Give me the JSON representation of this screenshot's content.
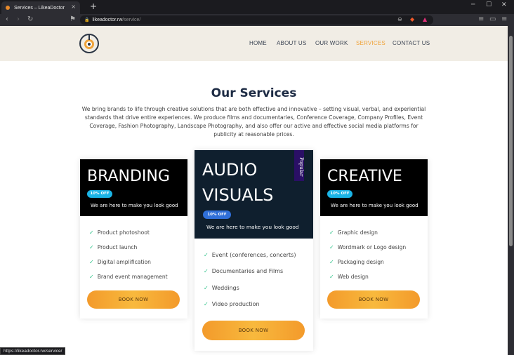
{
  "browser": {
    "tab_title": "Services – LikeaDoctor",
    "tab_close": "×",
    "new_tab": "+",
    "url_host": "likeadoctor.rw",
    "url_path": "/service/",
    "status_url": "https://likeadoctor.rw/service/",
    "win_min": "─",
    "win_max": "☐",
    "win_close": "✕"
  },
  "header": {
    "nav": [
      "HOME",
      "ABOUT US",
      "OUR WORK",
      "SERVICES",
      "CONTACT US"
    ],
    "active_index": 3
  },
  "main": {
    "title": "Our Services",
    "intro": "We bring brands to life through creative solutions that are both effective and innovative – setting visual, verbal, and experiential standards that drive entire experiences. We produce films and documentaries, Conference Coverage, Company Profiles, Event Coverage, Fashion Photography, Landscape Photography, and also offer our active and effective social media platforms for publicity at reasonable prices."
  },
  "cards": [
    {
      "title": "BRANDING",
      "badge": "10% OFF",
      "tagline": "We are here to make you look good",
      "features": [
        "Product photoshoot",
        "Product launch",
        "Digital amplification",
        "Brand event management"
      ],
      "button": "BOOK NOW"
    },
    {
      "title_line1": "AUDIO",
      "title_line2": "VISUALS",
      "badge": "10% OFF",
      "ribbon": "Popular",
      "tagline": "We are here to make you look good",
      "features": [
        "Event (conferences, concerts)",
        "Documentaries and Films",
        "Weddings",
        "Video production"
      ],
      "button": "BOOK NOW"
    },
    {
      "title": "CREATIVE",
      "badge": "10% OFF",
      "tagline": "We are here to make you look good",
      "features": [
        "Graphic design",
        "Wordmark or Logo design",
        "Packaging design",
        "Web design"
      ],
      "button": "BOOK NOW"
    }
  ],
  "colors": {
    "accent": "#f0a33a",
    "heading": "#1d2b44",
    "badge_cyan": "#1ab4e6",
    "badge_blue": "#2f6fd8",
    "card_dark": "#0f1f2e",
    "check": "#33c48c"
  },
  "icons": {
    "check": "✓"
  }
}
